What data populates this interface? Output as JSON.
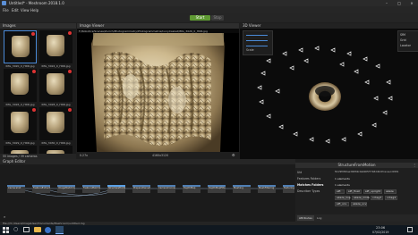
{
  "window": {
    "title": "Untitled* - Meshroom 2018.1.0"
  },
  "menu": [
    "File",
    "Edit",
    "View",
    "Help"
  ],
  "toolbar": {
    "start": "Start",
    "stop": "Stop"
  },
  "images_panel": {
    "title": "Images",
    "thumbs": [
      {
        "label": "IMG_3020_0_HDR.jpg"
      },
      {
        "label": "IMG_3024_0_HDR.jpg"
      },
      {
        "label": "IMG_3026_0_HDR.jpg"
      },
      {
        "label": "IMG_3028_0_HDR.jpg"
      },
      {
        "label": "IMG_3029_0_HDR.jpg"
      },
      {
        "label": "IMG_3030_0_HDR.jpg"
      }
    ],
    "footer": "55 images / 39 cameras"
  },
  "image_viewer": {
    "title": "Image Viewer",
    "path": "F:/Robotics/Scenes/Zurich/Photogrammetry/Photogrammetrie/IvoryCasket/IMG_3026_0_HDR.jpg",
    "zoom": "0.27x",
    "dims": "4160x3120"
  },
  "viewer_3d": {
    "title": "3D Viewer",
    "scale_label": "Scale",
    "menu": [
      "SfM",
      "Grid",
      "Locator"
    ]
  },
  "graph_editor": {
    "title": "Graph Editor",
    "nodes": [
      "CameraInit",
      "FeatureExtraction",
      "ImageMatching",
      "FeatureMatching",
      "StructureFromMotion",
      "PrepareDenseScene",
      "CameraConnection",
      "DepthMap",
      "DepthMapFilter",
      "Meshing",
      "MeshFiltering",
      "Texturing"
    ]
  },
  "attributes": {
    "title": "StructureFromMotion",
    "uid_label": "Uid",
    "uid": "f0c29f0f20ae300f69c9a6005f77b8dd0c0fcaceecd4581",
    "features_label": "Features Folders",
    "features_count": "1 elements",
    "matches_label": "Matches Folders",
    "matches_count": "1 elements",
    "describer_label": "Describer Types",
    "describers": [
      "sift",
      "sift_float",
      "sift_upright",
      "akaze",
      "akaze_liop",
      "akaze_mldb",
      "cctag3",
      "cctag4",
      "sift_ocv",
      "akaze_ocv"
    ],
    "tabs": [
      "Attributes",
      "Log"
    ]
  },
  "statusbar": {
    "text": "file:///C:/Users/ImageUser/Documents/Meshroom/untitled.mg"
  },
  "taskbar": {
    "time": "23:06",
    "date": "07/02/2019"
  }
}
